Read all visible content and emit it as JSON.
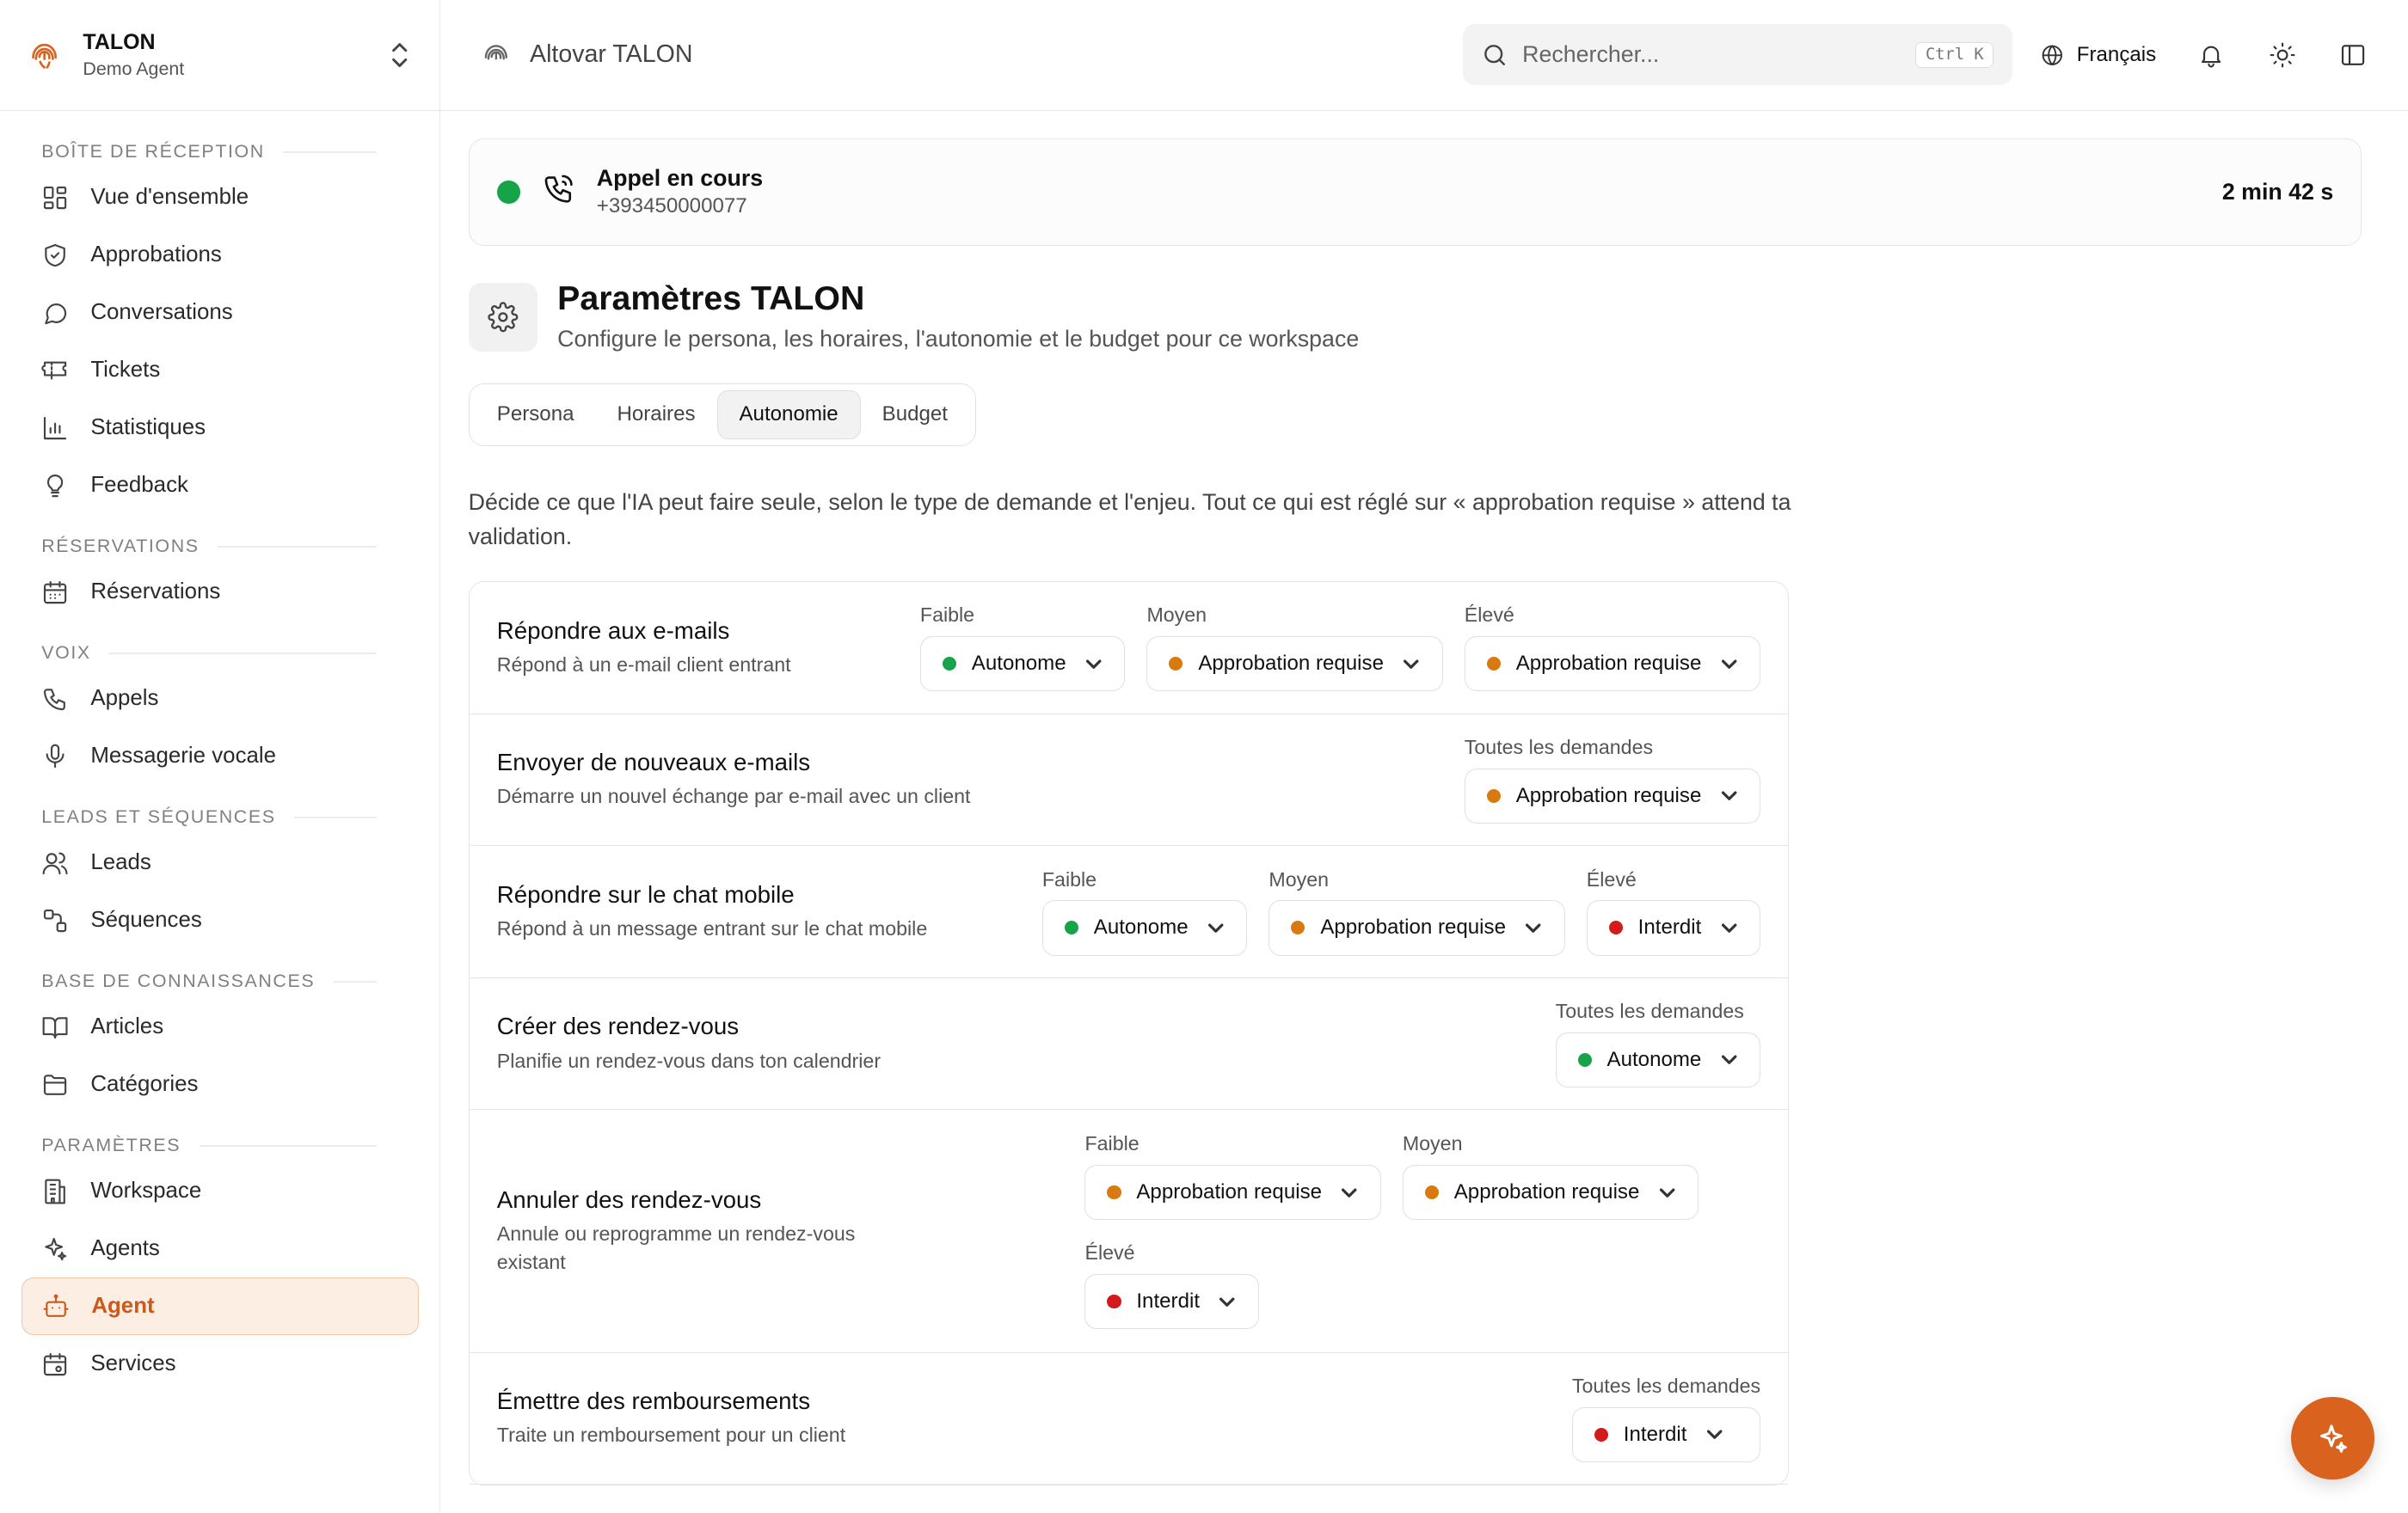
{
  "brand": {
    "title": "TALON",
    "subtitle": "Demo Agent"
  },
  "sidebar": {
    "sections": [
      {
        "title": "Boîte de réception",
        "items": [
          {
            "label": "Vue d'ensemble",
            "icon": "layout-grid-icon"
          },
          {
            "label": "Approbations",
            "icon": "shield-check-icon"
          },
          {
            "label": "Conversations",
            "icon": "chat-bubble-icon"
          },
          {
            "label": "Tickets",
            "icon": "ticket-icon"
          },
          {
            "label": "Statistiques",
            "icon": "bar-chart-icon"
          },
          {
            "label": "Feedback",
            "icon": "lightbulb-icon"
          }
        ]
      },
      {
        "title": "Réservations",
        "items": [
          {
            "label": "Réservations",
            "icon": "calendar-icon"
          }
        ]
      },
      {
        "title": "Voix",
        "items": [
          {
            "label": "Appels",
            "icon": "phone-icon"
          },
          {
            "label": "Messagerie vocale",
            "icon": "microphone-icon"
          }
        ]
      },
      {
        "title": "Leads et séquences",
        "items": [
          {
            "label": "Leads",
            "icon": "users-icon"
          },
          {
            "label": "Séquences",
            "icon": "sequence-icon"
          }
        ]
      },
      {
        "title": "Base de connaissances",
        "items": [
          {
            "label": "Articles",
            "icon": "book-icon"
          },
          {
            "label": "Catégories",
            "icon": "folder-icon"
          }
        ]
      },
      {
        "title": "Paramètres",
        "items": [
          {
            "label": "Workspace",
            "icon": "building-icon"
          },
          {
            "label": "Agents",
            "icon": "sparkles-icon"
          },
          {
            "label": "Agent",
            "icon": "robot-icon",
            "active": true
          },
          {
            "label": "Services",
            "icon": "calendar-settings-icon"
          }
        ]
      }
    ]
  },
  "topbar": {
    "title": "Altovar TALON",
    "search_placeholder": "Rechercher...",
    "shortcut": "Ctrl K",
    "language": "Français"
  },
  "call": {
    "title": "Appel en cours",
    "number": "+393450000077",
    "duration": "2 min 42 s",
    "status_color": "#17a34a"
  },
  "page": {
    "title": "Paramètres TALON",
    "subtitle": "Configure le persona, les horaires, l'autonomie et le budget pour ce workspace",
    "tabs": [
      {
        "label": "Persona"
      },
      {
        "label": "Horaires"
      },
      {
        "label": "Autonomie",
        "active": true
      },
      {
        "label": "Budget"
      }
    ],
    "intro": "Décide ce que l'IA peut faire seule, selon le type de demande et l'enjeu. Tout ce qui est réglé sur « approbation requise » attend ta validation."
  },
  "colors": {
    "autonome": "#17a34a",
    "approbation": "#d97a10",
    "interdit": "#d41a1a",
    "accent": "#d9621f"
  },
  "rules": [
    {
      "name": "Répondre aux e-mails",
      "desc": "Répond à un e-mail client entrant",
      "levels": [
        {
          "label": "Faible",
          "value": "Autonome",
          "status": "autonome"
        },
        {
          "label": "Moyen",
          "value": "Approbation requise",
          "status": "approbation"
        },
        {
          "label": "Élevé",
          "value": "Approbation requise",
          "status": "approbation"
        }
      ]
    },
    {
      "name": "Envoyer de nouveaux e-mails",
      "desc": "Démarre un nouvel échange par e-mail avec un client",
      "levels": [
        {
          "label": "Toutes les demandes",
          "value": "Approbation requise",
          "status": "approbation"
        }
      ]
    },
    {
      "name": "Répondre sur le chat mobile",
      "desc": "Répond à un message entrant sur le chat mobile",
      "levels": [
        {
          "label": "Faible",
          "value": "Autonome",
          "status": "autonome"
        },
        {
          "label": "Moyen",
          "value": "Approbation requise",
          "status": "approbation"
        },
        {
          "label": "Élevé",
          "value": "Interdit",
          "status": "interdit"
        }
      ]
    },
    {
      "name": "Créer des rendez-vous",
      "desc": "Planifie un rendez-vous dans ton calendrier",
      "levels": [
        {
          "label": "Toutes les demandes",
          "value": "Autonome",
          "status": "autonome"
        }
      ]
    },
    {
      "name": "Annuler des rendez-vous",
      "desc": "Annule ou reprogramme un rendez-vous existant",
      "levels": [
        {
          "label": "Faible",
          "value": "Approbation requise",
          "status": "approbation"
        },
        {
          "label": "Moyen",
          "value": "Approbation requise",
          "status": "approbation"
        },
        {
          "label": "Élevé",
          "value": "Interdit",
          "status": "interdit"
        }
      ]
    },
    {
      "name": "Émettre des remboursements",
      "desc": "Traite un remboursement pour un client",
      "levels": [
        {
          "label": "Toutes les demandes",
          "value": "Interdit",
          "status": "interdit"
        }
      ]
    }
  ]
}
